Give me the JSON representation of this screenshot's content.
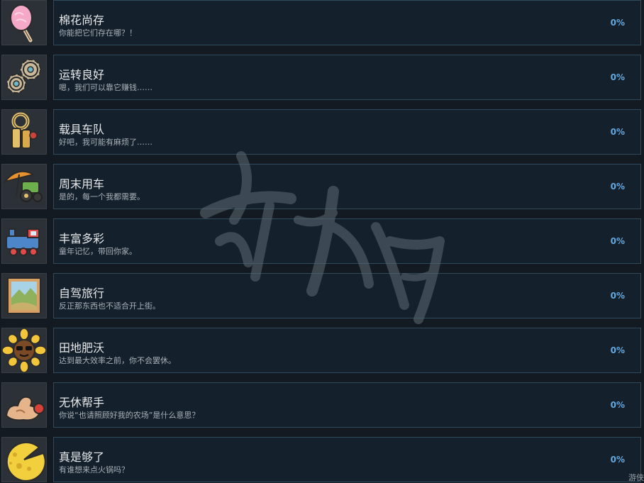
{
  "achievements": [
    {
      "icon": "cotton-candy-icon",
      "title": "棉花尚存",
      "desc": "你能把它们存在哪？！",
      "percent": "0%"
    },
    {
      "icon": "gears-icon",
      "title": "运转良好",
      "desc": "嗯，我们可以靠它赚钱……",
      "percent": "0%"
    },
    {
      "icon": "keys-icon",
      "title": "载具车队",
      "desc": "好吧，我可能有麻烦了……",
      "percent": "0%"
    },
    {
      "icon": "umbrella-tractor-icon",
      "title": "周末用车",
      "desc": "是的，每一个我都需要。",
      "percent": "0%"
    },
    {
      "icon": "train-icon",
      "title": "丰富多彩",
      "desc": "童年记忆，带回你家。",
      "percent": "0%"
    },
    {
      "icon": "landscape-picture-icon",
      "title": "自驾旅行",
      "desc": "反正那东西也不适合开上街。",
      "percent": "0%"
    },
    {
      "icon": "sunflower-sunglasses-icon",
      "title": "田地肥沃",
      "desc": "达到最大效率之前，你不会罢休。",
      "percent": "0%"
    },
    {
      "icon": "flexed-arm-icon",
      "title": "无休帮手",
      "desc": "你说“也请照顾好我的农场”是什么意思？",
      "percent": "0%"
    },
    {
      "icon": "cheese-icon",
      "title": "真是够了",
      "desc": "有谁想来点火锅吗？",
      "percent": "0%"
    }
  ],
  "corner_text": "游侠"
}
